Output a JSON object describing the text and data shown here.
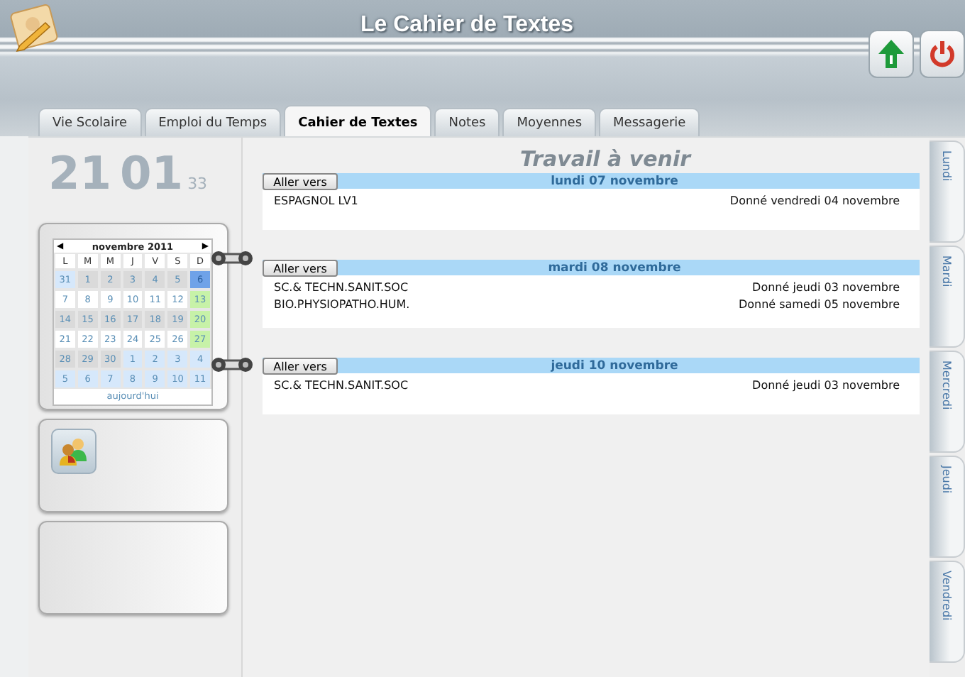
{
  "header": {
    "title": "Le Cahier de Textes"
  },
  "tabs": [
    {
      "label": "Vie Scolaire",
      "selected": false
    },
    {
      "label": "Emploi du Temps",
      "selected": false
    },
    {
      "label": "Cahier de Textes",
      "selected": true
    },
    {
      "label": "Notes",
      "selected": false
    },
    {
      "label": "Moyennes",
      "selected": false
    },
    {
      "label": "Messagerie",
      "selected": false
    }
  ],
  "clock": {
    "hours": "21",
    "minutes": "01",
    "seconds": "33"
  },
  "calendar": {
    "prev": "◀",
    "month": "novembre 2011",
    "next": "▶",
    "weekdays": [
      "L",
      "M",
      "M",
      "J",
      "V",
      "S",
      "D"
    ],
    "weeks": [
      [
        {
          "day": "31",
          "kind": "outside",
          "selected": false
        },
        {
          "day": "1",
          "kind": "weekday",
          "selected": false
        },
        {
          "day": "2",
          "kind": "weekday",
          "selected": false
        },
        {
          "day": "3",
          "kind": "weekday",
          "selected": false
        },
        {
          "day": "4",
          "kind": "weekday",
          "selected": false
        },
        {
          "day": "5",
          "kind": "weekday",
          "selected": false
        },
        {
          "day": "6",
          "kind": "sunday",
          "selected": true
        }
      ],
      [
        {
          "day": "7",
          "kind": "weekday",
          "selected": false
        },
        {
          "day": "8",
          "kind": "weekday",
          "selected": false
        },
        {
          "day": "9",
          "kind": "weekday",
          "selected": false
        },
        {
          "day": "10",
          "kind": "weekday",
          "selected": false
        },
        {
          "day": "11",
          "kind": "weekday",
          "selected": false
        },
        {
          "day": "12",
          "kind": "weekday",
          "selected": false
        },
        {
          "day": "13",
          "kind": "sunday",
          "selected": false
        }
      ],
      [
        {
          "day": "14",
          "kind": "weekday",
          "selected": false
        },
        {
          "day": "15",
          "kind": "weekday",
          "selected": false
        },
        {
          "day": "16",
          "kind": "weekday",
          "selected": false
        },
        {
          "day": "17",
          "kind": "weekday",
          "selected": false
        },
        {
          "day": "18",
          "kind": "weekday",
          "selected": false
        },
        {
          "day": "19",
          "kind": "weekday",
          "selected": false
        },
        {
          "day": "20",
          "kind": "sunday",
          "selected": false
        }
      ],
      [
        {
          "day": "21",
          "kind": "weekday",
          "selected": false
        },
        {
          "day": "22",
          "kind": "weekday",
          "selected": false
        },
        {
          "day": "23",
          "kind": "weekday",
          "selected": false
        },
        {
          "day": "24",
          "kind": "weekday",
          "selected": false
        },
        {
          "day": "25",
          "kind": "weekday",
          "selected": false
        },
        {
          "day": "26",
          "kind": "weekday",
          "selected": false
        },
        {
          "day": "27",
          "kind": "sunday",
          "selected": false
        }
      ],
      [
        {
          "day": "28",
          "kind": "weekday",
          "selected": false
        },
        {
          "day": "29",
          "kind": "weekday",
          "selected": false
        },
        {
          "day": "30",
          "kind": "weekday",
          "selected": false
        },
        {
          "day": "1",
          "kind": "outside",
          "selected": false
        },
        {
          "day": "2",
          "kind": "outside",
          "selected": false
        },
        {
          "day": "3",
          "kind": "outside",
          "selected": false
        },
        {
          "day": "4",
          "kind": "outside",
          "selected": false
        }
      ],
      [
        {
          "day": "5",
          "kind": "outside",
          "selected": false
        },
        {
          "day": "6",
          "kind": "outside",
          "selected": false
        },
        {
          "day": "7",
          "kind": "outside",
          "selected": false
        },
        {
          "day": "8",
          "kind": "outside",
          "selected": false
        },
        {
          "day": "9",
          "kind": "outside",
          "selected": false
        },
        {
          "day": "10",
          "kind": "outside",
          "selected": false
        },
        {
          "day": "11",
          "kind": "outside",
          "selected": false
        }
      ]
    ],
    "today": "aujourd'hui"
  },
  "main": {
    "title": "Travail à venir",
    "days": [
      {
        "button": "Aller vers",
        "date": "lundi 07 novembre",
        "items": [
          {
            "subject": "ESPAGNOL LV1",
            "given": "Donné vendredi 04 novembre"
          }
        ]
      },
      {
        "button": "Aller vers",
        "date": "mardi 08 novembre",
        "items": [
          {
            "subject": "SC.& TECHN.SANIT.SOC",
            "given": "Donné jeudi 03 novembre"
          },
          {
            "subject": "BIO.PHYSIOPATHO.HUM.",
            "given": "Donné samedi 05 novembre"
          }
        ]
      },
      {
        "button": "Aller vers",
        "date": "jeudi 10 novembre",
        "items": [
          {
            "subject": "SC.& TECHN.SANIT.SOC",
            "given": "Donné jeudi 03 novembre"
          }
        ]
      }
    ]
  },
  "day_tabs": [
    {
      "label": "Lundi"
    },
    {
      "label": "Mardi"
    },
    {
      "label": "Mercredi"
    },
    {
      "label": "Jeudi"
    },
    {
      "label": "Vendredi"
    }
  ]
}
